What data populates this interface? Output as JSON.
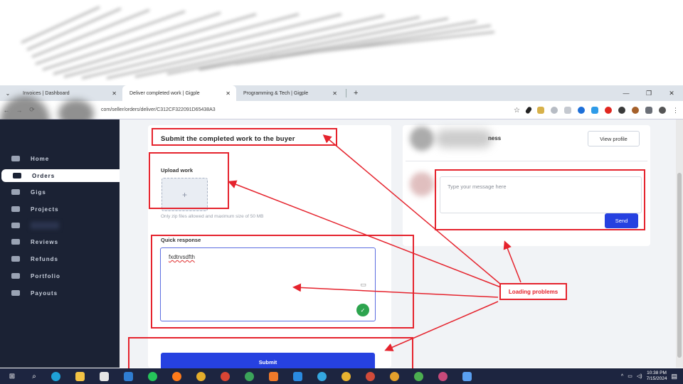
{
  "browser": {
    "tabs": [
      {
        "title": "Invoices | Dashboard",
        "active": false
      },
      {
        "title": "Deliver completed work | Gigple",
        "active": true
      },
      {
        "title": "Programming & Tech | Gigple",
        "active": false
      }
    ],
    "tab_close": "✕",
    "new_tab": "+",
    "url": "com/seller/orders/deliver/C312CF322091D65438A3",
    "window_controls": {
      "minimize": "—",
      "restore": "❐",
      "close": "✕"
    }
  },
  "sidebar": {
    "items": [
      {
        "label": "Home",
        "active": false
      },
      {
        "label": "Orders",
        "active": true
      },
      {
        "label": "Gigs",
        "active": false
      },
      {
        "label": "Projects",
        "active": false
      },
      {
        "label": "",
        "active": false
      },
      {
        "label": "Reviews",
        "active": false
      },
      {
        "label": "Refunds",
        "active": false
      },
      {
        "label": "Portfolio",
        "active": false
      },
      {
        "label": "Payouts",
        "active": false
      }
    ]
  },
  "deliver_form": {
    "title": "Submit the completed work to the buyer",
    "upload_label": "Upload work",
    "upload_plus": "+",
    "upload_hint": "Only zip files allowed and maximum size of 50 MB",
    "quick_response_label": "Quick response",
    "quick_response_value": "fxdtrvsdfth",
    "submit_label": "Submit"
  },
  "buyer_panel": {
    "name_suffix": "ness",
    "view_profile_label": "View profile",
    "message_placeholder": "Type your message here",
    "send_label": "Send"
  },
  "annotation": {
    "label": "Loading problems",
    "color": "#e5232d"
  },
  "taskbar": {
    "time": "10:38 PM",
    "date": "7/15/2024"
  },
  "colors": {
    "sidebar_bg": "#1b2234",
    "primary_button": "#2641e0",
    "taskbar_bg": "#1d2540"
  }
}
